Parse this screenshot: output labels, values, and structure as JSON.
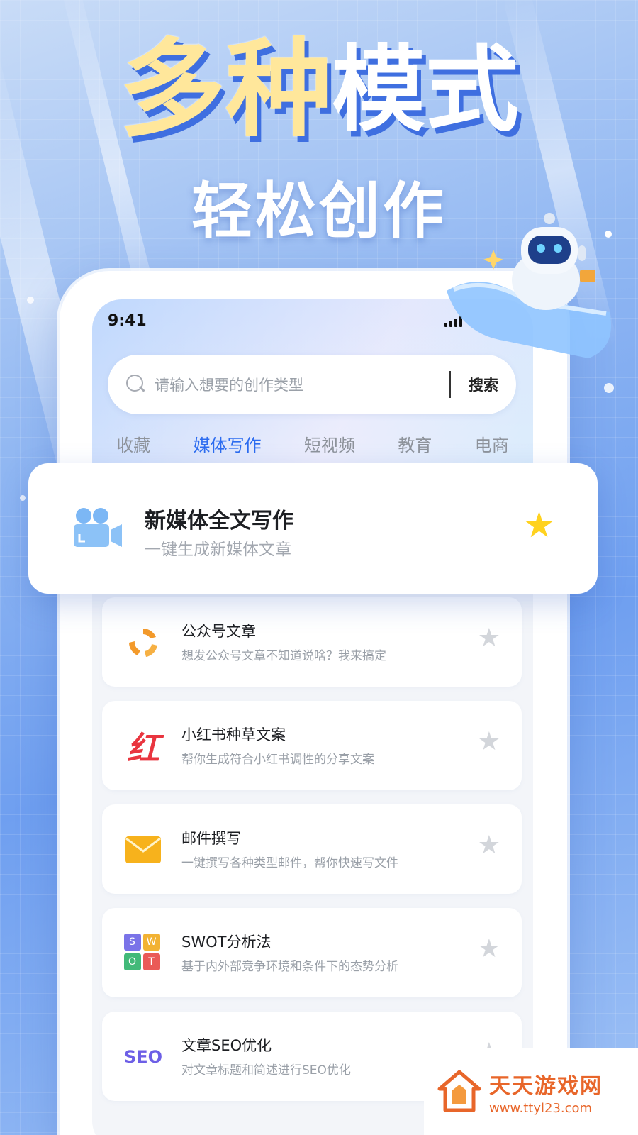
{
  "headline": {
    "part1": "多种",
    "part2": "模式",
    "subtitle": "轻松创作"
  },
  "status_bar": {
    "time": "9:41"
  },
  "search": {
    "placeholder": "请输入想要的创作类型",
    "button": "搜索"
  },
  "tabs": [
    {
      "label": "收藏",
      "active": false
    },
    {
      "label": "媒体写作",
      "active": true
    },
    {
      "label": "短视频",
      "active": false
    },
    {
      "label": "教育",
      "active": false
    },
    {
      "label": "电商",
      "active": false
    }
  ],
  "featured": {
    "title": "新媒体全文写作",
    "desc": "一键生成新媒体文章",
    "icon": "video-camera-icon",
    "starred": true
  },
  "items": [
    {
      "title": "公众号文章",
      "desc": "想发公众号文章不知道说啥？我来搞定",
      "icon": "wechat-official-icon",
      "starred": false
    },
    {
      "title": "小红书种草文案",
      "desc": "帮你生成符合小红书调性的分享文案",
      "icon": "xiaohongshu-icon",
      "icon_text": "红",
      "starred": false
    },
    {
      "title": "邮件撰写",
      "desc": "一键撰写各种类型邮件，帮你快速写文件",
      "icon": "mail-envelope-icon",
      "starred": false
    },
    {
      "title": "SWOT分析法",
      "desc": "基于内外部竞争环境和条件下的态势分析",
      "icon": "swot-icon",
      "icon_letters": [
        "S",
        "W",
        "O",
        "T"
      ],
      "starred": false
    },
    {
      "title": "文章SEO优化",
      "desc": "对文章标题和简述进行SEO优化",
      "icon": "seo-icon",
      "icon_text": "SEO",
      "starred": false
    }
  ],
  "watermark": {
    "name": "天天游戏网",
    "url": "www.ttyl23.com"
  },
  "colors": {
    "accent": "#2c6cf0",
    "star_active": "#ffd21f",
    "star_inactive": "#d3d6db",
    "headline_yellow": "#ffe79b"
  }
}
